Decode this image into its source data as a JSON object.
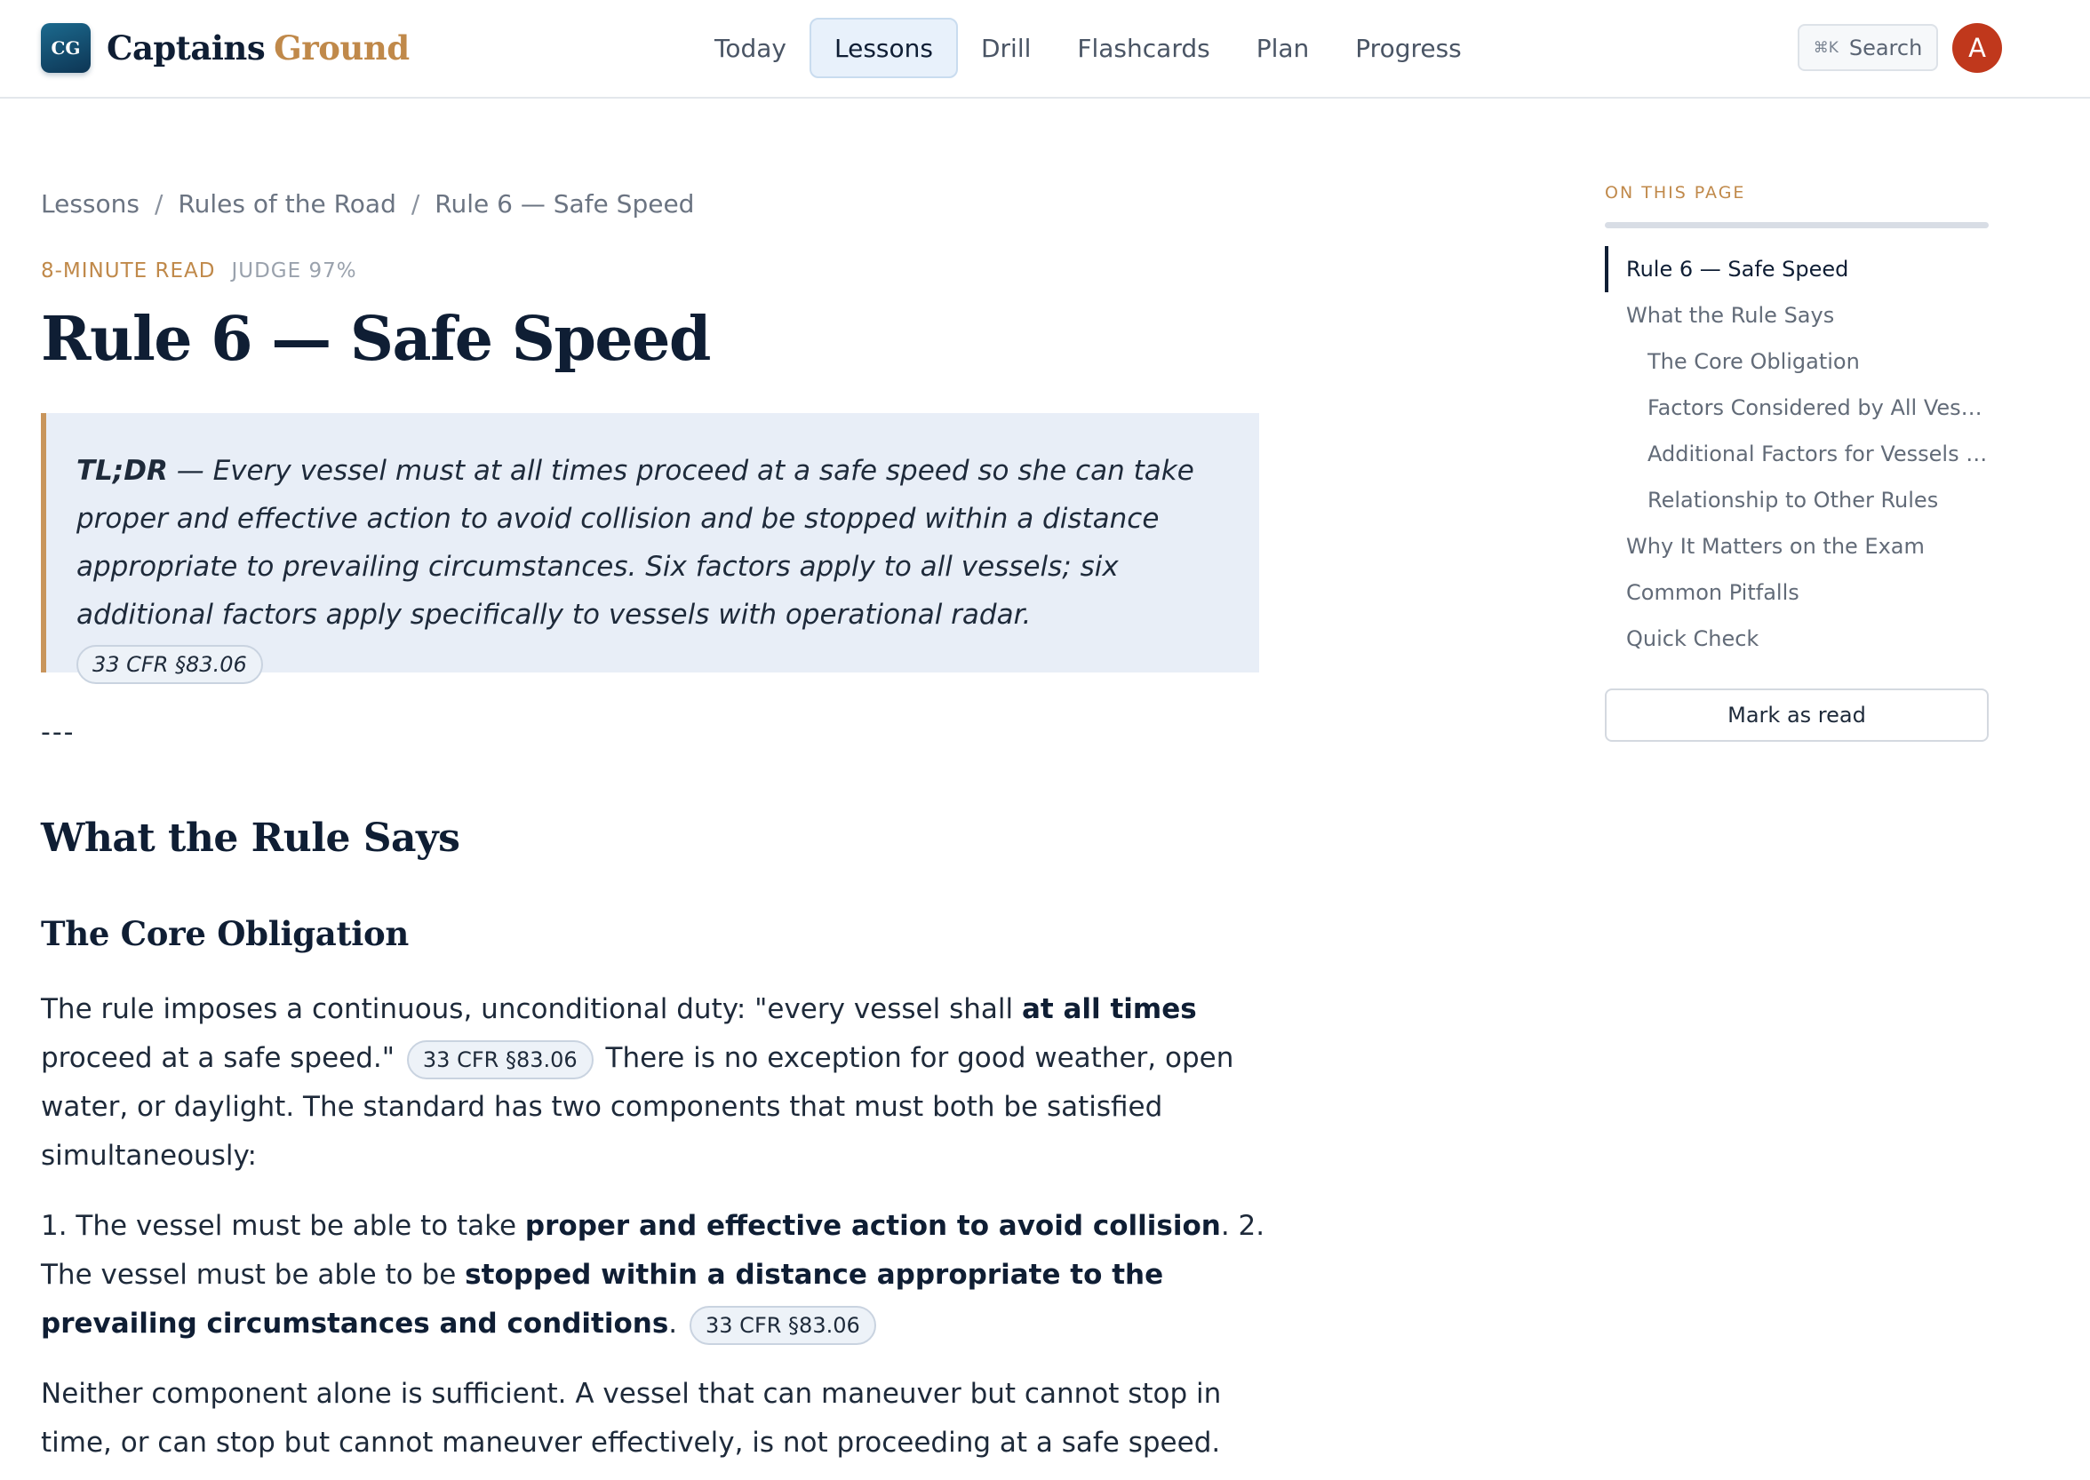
{
  "header": {
    "logo_mark": "CG",
    "brand_primary": "Captains",
    "brand_accent": "Ground",
    "nav": [
      {
        "label": "Today",
        "active": false
      },
      {
        "label": "Lessons",
        "active": true
      },
      {
        "label": "Drill",
        "active": false
      },
      {
        "label": "Flashcards",
        "active": false
      },
      {
        "label": "Plan",
        "active": false
      },
      {
        "label": "Progress",
        "active": false
      }
    ],
    "search": {
      "shortcut": "⌘K",
      "label": "Search"
    },
    "avatar_initial": "A"
  },
  "breadcrumb": [
    "Lessons",
    "Rules of the Road",
    "Rule 6 — Safe Speed"
  ],
  "meta": {
    "read_time": "8-MINUTE READ",
    "judge": "JUDGE 97%"
  },
  "article": {
    "title": "Rule 6 — Safe Speed",
    "tldr": {
      "label": "TL;DR",
      "text": " — Every vessel must at all times proceed at a safe speed so she can take proper and effective action to avoid collision and be stopped within a distance appropriate to prevailing circumstances. Six factors apply to all vessels; six additional factors apply specifically to vessels with operational radar. ",
      "cite": "33 CFR §83.06"
    },
    "divider": "---",
    "section_heading": "What the Rule Says",
    "subsection_heading": "The Core Obligation",
    "p1": {
      "a": "The rule imposes a continuous, unconditional duty: \"every vessel shall ",
      "bold": "at all times",
      "b": " proceed at a safe speed.\"",
      "cite": "33 CFR §83.06",
      "c": "There is no exception for good weather, open water, or daylight. The standard has two components that must both be satisfied simultaneously:"
    },
    "p2": {
      "a": "1. The vessel must be able to take ",
      "bold1": "proper and effective action to avoid collision",
      "b": ". 2. The vessel must be able to be ",
      "bold2": "stopped within a distance appropriate to the prevailing circumstances and conditions",
      "c": ".",
      "cite": "33 CFR §83.06"
    },
    "p3": "Neither component alone is sufficient. A vessel that can maneuver but cannot stop in time, or can stop but cannot maneuver effectively, is not proceeding at a safe speed."
  },
  "toc": {
    "title": "ON THIS PAGE",
    "items": [
      {
        "label": "Rule 6 — Safe Speed",
        "level": 1,
        "active": true
      },
      {
        "label": "What the Rule Says",
        "level": 1,
        "active": false
      },
      {
        "label": "The Core Obligation",
        "level": 2,
        "active": false
      },
      {
        "label": "Factors Considered by All Vesse...",
        "level": 2,
        "active": false
      },
      {
        "label": "Additional Factors for Vessels wi...",
        "level": 2,
        "active": false
      },
      {
        "label": "Relationship to Other Rules",
        "level": 2,
        "active": false
      },
      {
        "label": "Why It Matters on the Exam",
        "level": 1,
        "active": false
      },
      {
        "label": "Common Pitfalls",
        "level": 1,
        "active": false
      },
      {
        "label": "Quick Check",
        "level": 1,
        "active": false
      }
    ],
    "mark_read_label": "Mark as read"
  },
  "colors": {
    "brand_navy": "#0f1e34",
    "brand_gold": "#c0894a",
    "avatar": "#c0381c",
    "tldr_bg": "#e8eef7",
    "tldr_border": "#c8955c"
  }
}
